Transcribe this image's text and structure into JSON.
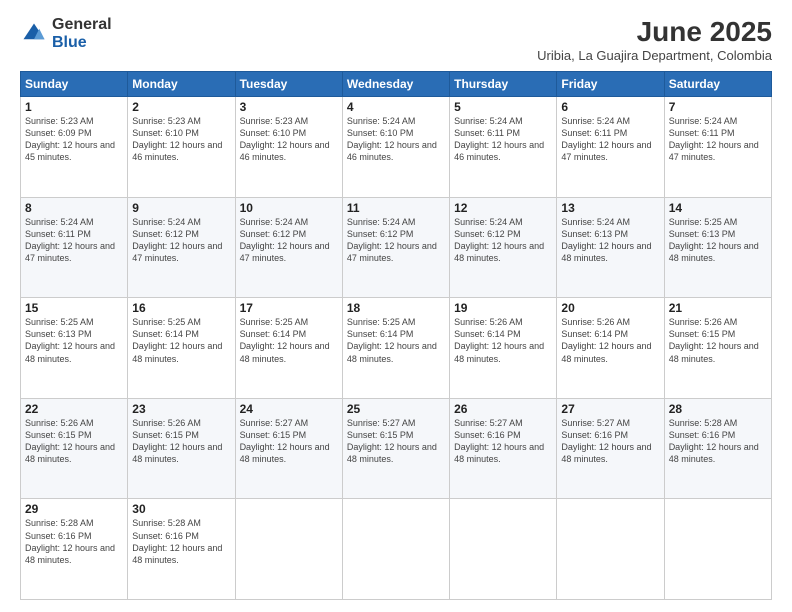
{
  "logo": {
    "general": "General",
    "blue": "Blue"
  },
  "title": "June 2025",
  "subtitle": "Uribia, La Guajira Department, Colombia",
  "days_of_week": [
    "Sunday",
    "Monday",
    "Tuesday",
    "Wednesday",
    "Thursday",
    "Friday",
    "Saturday"
  ],
  "weeks": [
    [
      {
        "day": "1",
        "sunrise": "5:23 AM",
        "sunset": "6:09 PM",
        "daylight": "12 hours and 45 minutes."
      },
      {
        "day": "2",
        "sunrise": "5:23 AM",
        "sunset": "6:10 PM",
        "daylight": "12 hours and 46 minutes."
      },
      {
        "day": "3",
        "sunrise": "5:23 AM",
        "sunset": "6:10 PM",
        "daylight": "12 hours and 46 minutes."
      },
      {
        "day": "4",
        "sunrise": "5:24 AM",
        "sunset": "6:10 PM",
        "daylight": "12 hours and 46 minutes."
      },
      {
        "day": "5",
        "sunrise": "5:24 AM",
        "sunset": "6:11 PM",
        "daylight": "12 hours and 46 minutes."
      },
      {
        "day": "6",
        "sunrise": "5:24 AM",
        "sunset": "6:11 PM",
        "daylight": "12 hours and 47 minutes."
      },
      {
        "day": "7",
        "sunrise": "5:24 AM",
        "sunset": "6:11 PM",
        "daylight": "12 hours and 47 minutes."
      }
    ],
    [
      {
        "day": "8",
        "sunrise": "5:24 AM",
        "sunset": "6:11 PM",
        "daylight": "12 hours and 47 minutes."
      },
      {
        "day": "9",
        "sunrise": "5:24 AM",
        "sunset": "6:12 PM",
        "daylight": "12 hours and 47 minutes."
      },
      {
        "day": "10",
        "sunrise": "5:24 AM",
        "sunset": "6:12 PM",
        "daylight": "12 hours and 47 minutes."
      },
      {
        "day": "11",
        "sunrise": "5:24 AM",
        "sunset": "6:12 PM",
        "daylight": "12 hours and 47 minutes."
      },
      {
        "day": "12",
        "sunrise": "5:24 AM",
        "sunset": "6:12 PM",
        "daylight": "12 hours and 48 minutes."
      },
      {
        "day": "13",
        "sunrise": "5:24 AM",
        "sunset": "6:13 PM",
        "daylight": "12 hours and 48 minutes."
      },
      {
        "day": "14",
        "sunrise": "5:25 AM",
        "sunset": "6:13 PM",
        "daylight": "12 hours and 48 minutes."
      }
    ],
    [
      {
        "day": "15",
        "sunrise": "5:25 AM",
        "sunset": "6:13 PM",
        "daylight": "12 hours and 48 minutes."
      },
      {
        "day": "16",
        "sunrise": "5:25 AM",
        "sunset": "6:14 PM",
        "daylight": "12 hours and 48 minutes."
      },
      {
        "day": "17",
        "sunrise": "5:25 AM",
        "sunset": "6:14 PM",
        "daylight": "12 hours and 48 minutes."
      },
      {
        "day": "18",
        "sunrise": "5:25 AM",
        "sunset": "6:14 PM",
        "daylight": "12 hours and 48 minutes."
      },
      {
        "day": "19",
        "sunrise": "5:26 AM",
        "sunset": "6:14 PM",
        "daylight": "12 hours and 48 minutes."
      },
      {
        "day": "20",
        "sunrise": "5:26 AM",
        "sunset": "6:14 PM",
        "daylight": "12 hours and 48 minutes."
      },
      {
        "day": "21",
        "sunrise": "5:26 AM",
        "sunset": "6:15 PM",
        "daylight": "12 hours and 48 minutes."
      }
    ],
    [
      {
        "day": "22",
        "sunrise": "5:26 AM",
        "sunset": "6:15 PM",
        "daylight": "12 hours and 48 minutes."
      },
      {
        "day": "23",
        "sunrise": "5:26 AM",
        "sunset": "6:15 PM",
        "daylight": "12 hours and 48 minutes."
      },
      {
        "day": "24",
        "sunrise": "5:27 AM",
        "sunset": "6:15 PM",
        "daylight": "12 hours and 48 minutes."
      },
      {
        "day": "25",
        "sunrise": "5:27 AM",
        "sunset": "6:15 PM",
        "daylight": "12 hours and 48 minutes."
      },
      {
        "day": "26",
        "sunrise": "5:27 AM",
        "sunset": "6:16 PM",
        "daylight": "12 hours and 48 minutes."
      },
      {
        "day": "27",
        "sunrise": "5:27 AM",
        "sunset": "6:16 PM",
        "daylight": "12 hours and 48 minutes."
      },
      {
        "day": "28",
        "sunrise": "5:28 AM",
        "sunset": "6:16 PM",
        "daylight": "12 hours and 48 minutes."
      }
    ],
    [
      {
        "day": "29",
        "sunrise": "5:28 AM",
        "sunset": "6:16 PM",
        "daylight": "12 hours and 48 minutes."
      },
      {
        "day": "30",
        "sunrise": "5:28 AM",
        "sunset": "6:16 PM",
        "daylight": "12 hours and 48 minutes."
      },
      null,
      null,
      null,
      null,
      null
    ]
  ]
}
